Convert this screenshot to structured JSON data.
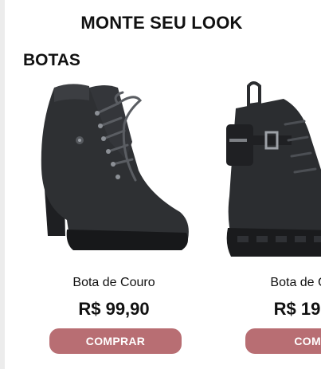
{
  "page": {
    "title": "MONTE SEU LOOK"
  },
  "section": {
    "title": "BOTAS"
  },
  "products": [
    {
      "name": "Bota de Couro",
      "price": "R$ 99,90",
      "button_label": "COMPRAR",
      "image_icon": "heeled-lace-up-boot"
    },
    {
      "name": "Bota de C",
      "price": "R$ 19",
      "button_label": "COMP",
      "image_icon": "combat-boot-with-pouch"
    }
  ],
  "colors": {
    "button_bg": "#b86e73",
    "button_text": "#ffffff",
    "boot": "#2b2d30"
  }
}
